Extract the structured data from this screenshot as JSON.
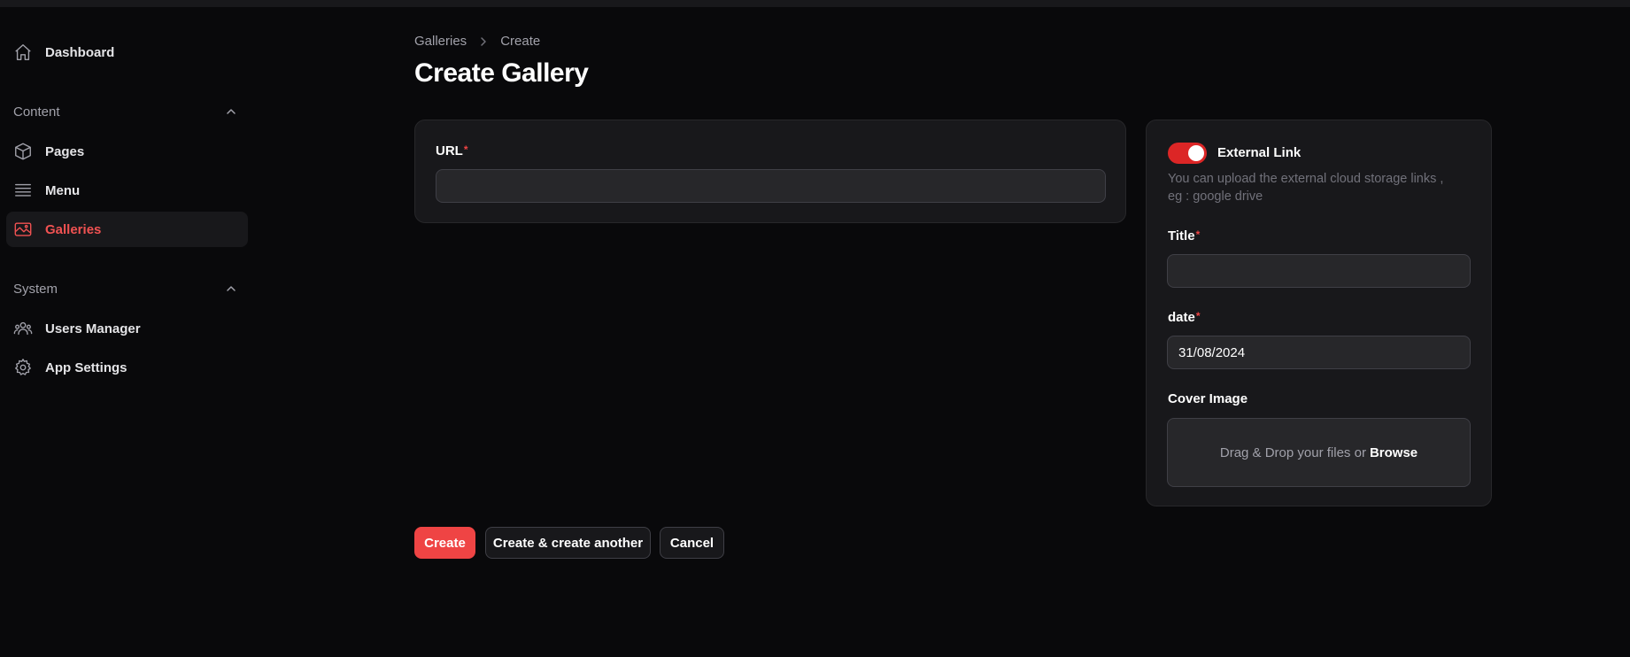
{
  "sidebar": {
    "dashboard": {
      "label": "Dashboard",
      "icon": "home-icon"
    },
    "groups": [
      {
        "label": "Content",
        "items": [
          {
            "label": "Pages",
            "icon": "cube-icon"
          },
          {
            "label": "Menu",
            "icon": "menu-lines-icon"
          },
          {
            "label": "Galleries",
            "icon": "image-icon",
            "active": true
          }
        ]
      },
      {
        "label": "System",
        "items": [
          {
            "label": "Users Manager",
            "icon": "users-icon"
          },
          {
            "label": "App Settings",
            "icon": "gear-icon"
          }
        ]
      }
    ]
  },
  "header": {
    "breadcrumb": [
      "Galleries",
      "Create"
    ],
    "title": "Create Gallery"
  },
  "form": {
    "url": {
      "label": "URL",
      "required_mark": "*",
      "value": ""
    },
    "external_link": {
      "label": "External Link",
      "enabled": true,
      "helper": "You can upload the external cloud storage links , eg : google drive"
    },
    "title": {
      "label": "Title",
      "required_mark": "*",
      "value": ""
    },
    "date": {
      "label": "date",
      "required_mark": "*",
      "value": "31/08/2024"
    },
    "cover_image": {
      "label": "Cover Image",
      "drop_text": "Drag & Drop your files or",
      "browse_text": "Browse"
    }
  },
  "actions": {
    "create": "Create",
    "create_another": "Create & create another",
    "cancel": "Cancel"
  },
  "colors": {
    "accent": "#ef4444",
    "background": "#09090b",
    "card": "#18181b"
  }
}
